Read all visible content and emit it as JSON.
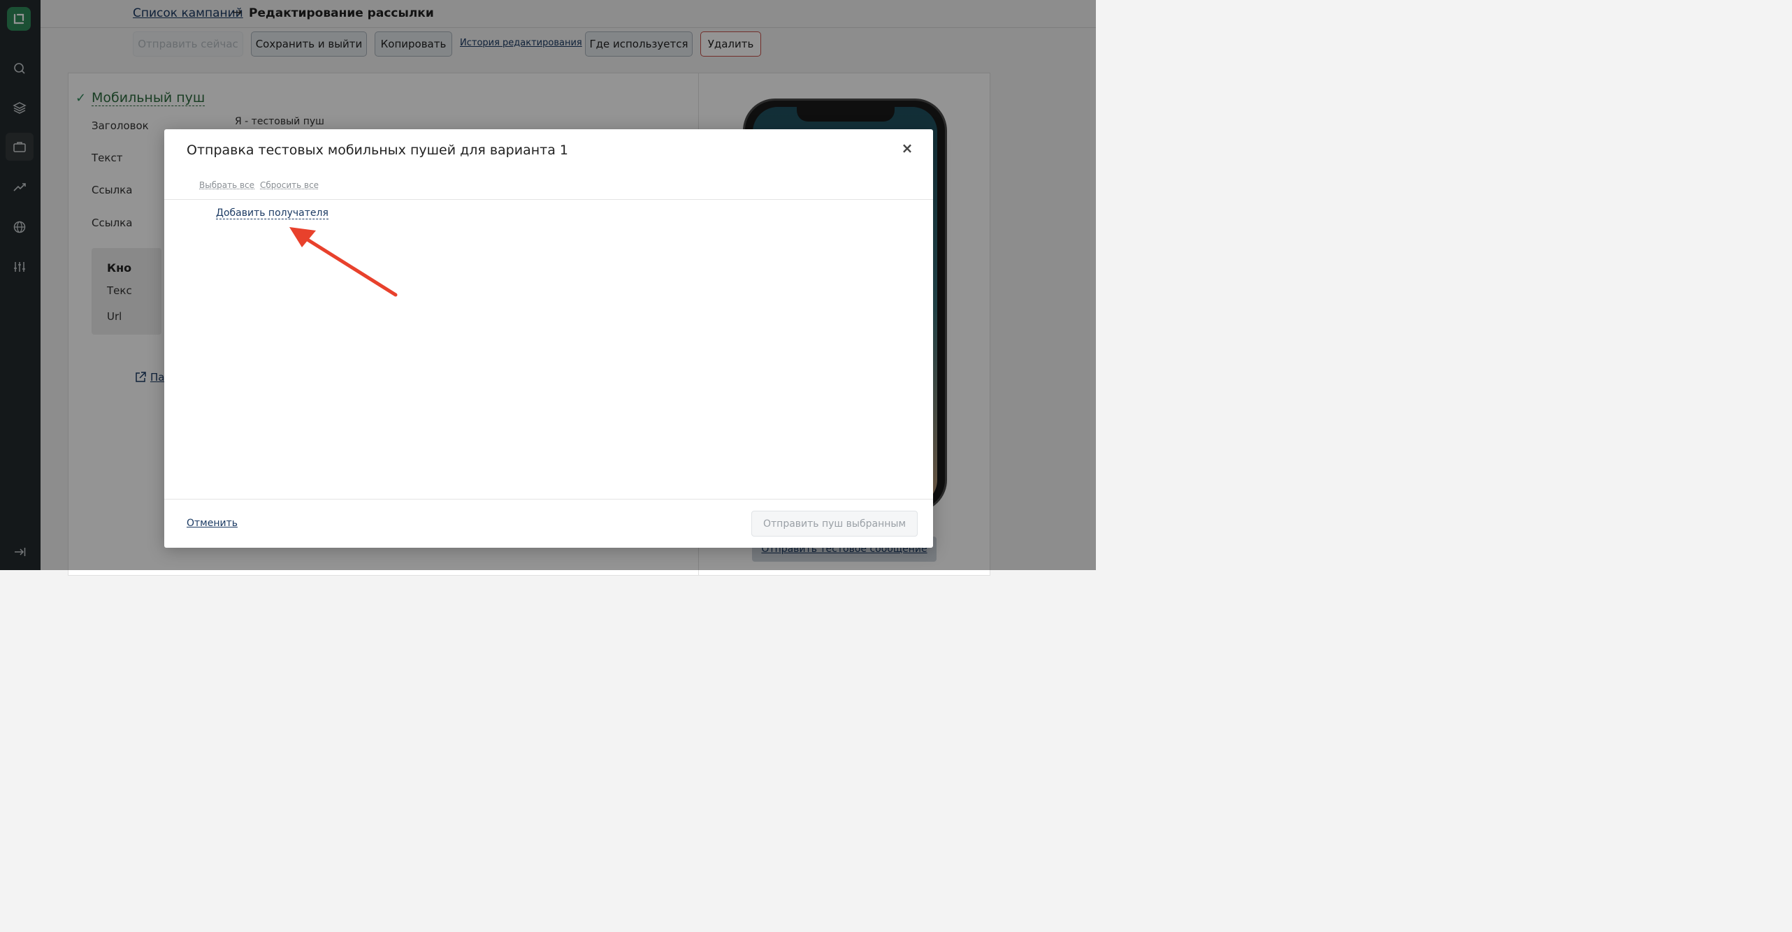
{
  "breadcrumb": {
    "parent": "Список кампаний",
    "arrow": "→",
    "current": "Редактирование рассылки"
  },
  "toolbar": {
    "send_now": "Отправить сейчас",
    "save_exit": "Сохранить и выйти",
    "copy": "Копировать",
    "history": "История редактирования",
    "where_used": "Где используется",
    "delete": "Удалить"
  },
  "section": {
    "title": "Мобильный пуш",
    "fields": {
      "header_label": "Заголовок",
      "header_value": "Я - тестовый пуш",
      "text_label": "Текст",
      "link1_label": "Ссылка",
      "link2_label": "Ссылка"
    },
    "buttons_box": {
      "title": "Кно",
      "text_label": "Текс",
      "url_label": "Url"
    },
    "preview_link": "Пар"
  },
  "preview": {
    "send_test": "Отправить тестовое сообщение"
  },
  "modal": {
    "title": "Отправка тестовых мобильных пушей для варианта 1",
    "close": "×",
    "select_all": "Выбрать все",
    "reset_all": "Сбросить все",
    "add_recipient": "Добавить получателя",
    "cancel": "Отменить",
    "send_selected": "Отправить пуш выбранным"
  },
  "colors": {
    "sidebar": "#232a2d",
    "brand": "#2f8a5b",
    "link": "#1b3a63",
    "annotation": "#e8412c"
  },
  "icons": [
    "logo-icon",
    "search-icon",
    "layers-icon",
    "briefcase-icon",
    "chart-icon",
    "globe-icon",
    "sliders-icon",
    "logout-icon"
  ]
}
